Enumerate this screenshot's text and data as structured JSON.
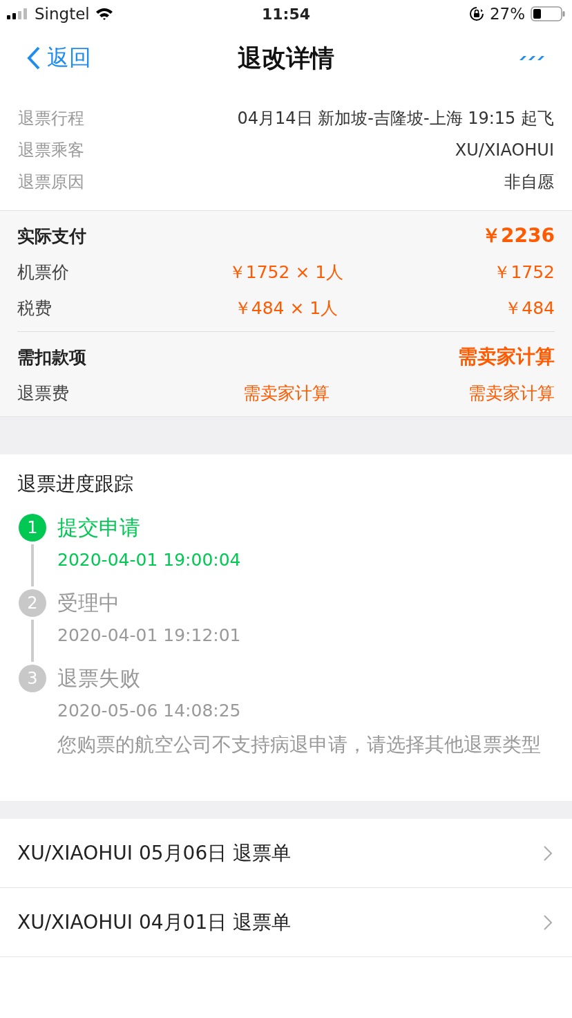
{
  "status_bar": {
    "carrier": "Singtel",
    "time": "11:54",
    "battery": "27%"
  },
  "nav": {
    "back": "返回",
    "title": "退改详情"
  },
  "info": [
    {
      "label": "退票行程",
      "value": "04月14日 新加坡-吉隆坡-上海 19:15 起飞"
    },
    {
      "label": "退票乘客",
      "value": "XU/XIAOHUI"
    },
    {
      "label": "退票原因",
      "value": "非自愿"
    }
  ],
  "payment": [
    {
      "label": "实际支付",
      "value": "￥2236",
      "items": [
        {
          "label": "机票价",
          "unit": "￥1752 × 1人",
          "total": "￥1752"
        },
        {
          "label": "税费",
          "unit": "￥484 × 1人",
          "total": "￥484"
        }
      ]
    },
    {
      "label": "需扣款项",
      "value": "需卖家计算",
      "items": [
        {
          "label": "退票费",
          "unit": "需卖家计算",
          "total": "需卖家计算"
        }
      ]
    }
  ],
  "progress": {
    "title": "退票进度跟踪",
    "steps": [
      {
        "number": "1",
        "title": "提交申请",
        "time": "2020-04-01 19:00:04",
        "completed": true
      },
      {
        "number": "2",
        "title": "受理中",
        "time": "2020-04-01 19:12:01",
        "completed": false
      },
      {
        "number": "3",
        "title": "退票失败",
        "time": "2020-05-06 14:08:25",
        "note": "您购票的航空公司不支持病退申请，请选择其他退票类型",
        "completed": false
      }
    ]
  },
  "records": [
    {
      "label": "XU/XIAOHUI 05月06日 退票单"
    },
    {
      "label": "XU/XIAOHUI 04月01日 退票单"
    }
  ]
}
